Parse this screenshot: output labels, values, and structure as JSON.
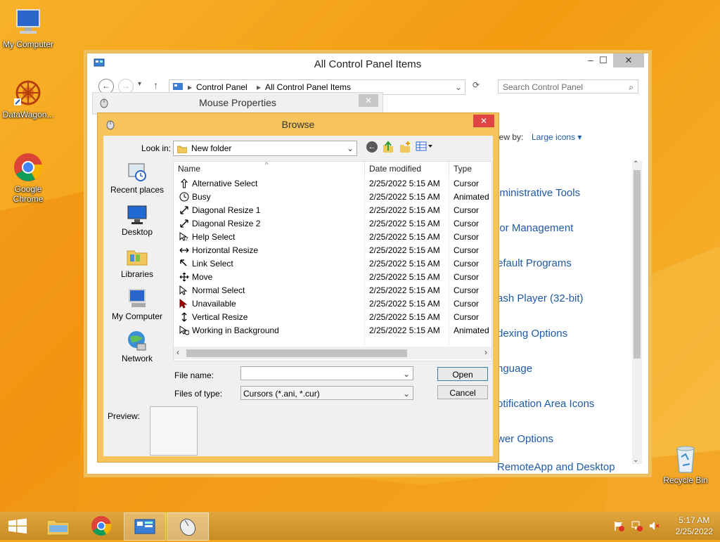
{
  "desktop": {
    "icons": [
      {
        "label": "My Computer",
        "icon": "my-computer-icon"
      },
      {
        "label": "DataWagon...",
        "icon": "datawagon-icon"
      },
      {
        "label": "Google Chrome",
        "icon": "chrome-icon"
      },
      {
        "label": "Recycle Bin",
        "icon": "recycle-bin-icon"
      }
    ]
  },
  "control_panel": {
    "title": "All Control Panel Items",
    "breadcrumb": [
      "Control Panel",
      "All Control Panel Items"
    ],
    "search_placeholder": "Search Control Panel",
    "view_by_label": "iew by:",
    "view_by_value": "Large icons",
    "items": [
      "lministrative Tools",
      "lor Management",
      "efault Programs",
      "ash Player (32-bit)",
      "dexing Options",
      "nguage",
      "otification Area Icons",
      "wer Options",
      "RemoteApp and Desktop"
    ]
  },
  "mouse_properties": {
    "title": "Mouse Properties"
  },
  "browse": {
    "title": "Browse",
    "look_in_label": "Look in:",
    "look_in_value": "New folder",
    "places": [
      "Recent places",
      "Desktop",
      "Libraries",
      "My Computer",
      "Network"
    ],
    "columns": {
      "name": "Name",
      "date": "Date modified",
      "type": "Type"
    },
    "files": [
      {
        "name": "Alternative Select",
        "date": "2/25/2022 5:15 AM",
        "type": "Cursor",
        "icon": "arrow-up-icon"
      },
      {
        "name": "Busy",
        "date": "2/25/2022 5:15 AM",
        "type": "Animated",
        "icon": "busy-icon"
      },
      {
        "name": "Diagonal Resize 1",
        "date": "2/25/2022 5:15 AM",
        "type": "Cursor",
        "icon": "diag-resize-icon"
      },
      {
        "name": "Diagonal Resize 2",
        "date": "2/25/2022 5:15 AM",
        "type": "Cursor",
        "icon": "diag-resize-icon"
      },
      {
        "name": "Help Select",
        "date": "2/25/2022 5:15 AM",
        "type": "Cursor",
        "icon": "help-cursor-icon"
      },
      {
        "name": "Horizontal Resize",
        "date": "2/25/2022 5:15 AM",
        "type": "Cursor",
        "icon": "horiz-resize-icon"
      },
      {
        "name": "Link Select",
        "date": "2/25/2022 5:15 AM",
        "type": "Cursor",
        "icon": "link-cursor-icon"
      },
      {
        "name": "Move",
        "date": "2/25/2022 5:15 AM",
        "type": "Cursor",
        "icon": "move-icon"
      },
      {
        "name": "Normal Select",
        "date": "2/25/2022 5:15 AM",
        "type": "Cursor",
        "icon": "arrow-cursor-icon"
      },
      {
        "name": "Unavailable",
        "date": "2/25/2022 5:15 AM",
        "type": "Cursor",
        "icon": "unavailable-icon"
      },
      {
        "name": "Vertical Resize",
        "date": "2/25/2022 5:15 AM",
        "type": "Cursor",
        "icon": "vert-resize-icon"
      },
      {
        "name": "Working in Background",
        "date": "2/25/2022 5:15 AM",
        "type": "Animated",
        "icon": "working-icon"
      }
    ],
    "file_name_label": "File name:",
    "file_name_value": "",
    "files_of_type_label": "Files of type:",
    "files_of_type_value": "Cursors (*.ani, *.cur)",
    "open_label": "Open",
    "cancel_label": "Cancel",
    "preview_label": "Preview:"
  },
  "taskbar": {
    "time": "5:17 AM",
    "date": "2/25/2022"
  },
  "colors": {
    "accent": "#f4a51c",
    "dialog_frame": "#f6c45a",
    "close_red": "#e04343",
    "link_blue": "#1e5aa8"
  }
}
